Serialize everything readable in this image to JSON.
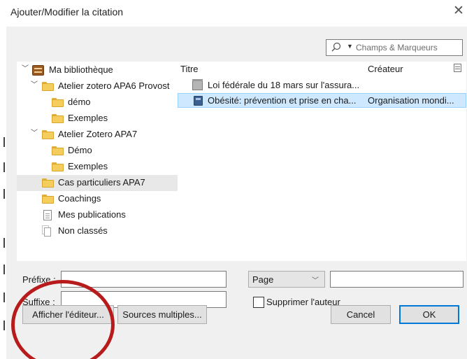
{
  "window": {
    "title": "Ajouter/Modifier la citation",
    "close_glyph": "✕"
  },
  "search": {
    "placeholder": "Champs & Marqueurs",
    "icon": "search-icon",
    "dropdown_icon": "caret-down-icon"
  },
  "tree": [
    {
      "label": "Ma bibliothèque",
      "icon": "library-icon",
      "expanded": true,
      "level": 0
    },
    {
      "label": "Atelier zotero APA6 Provost",
      "icon": "folder-icon",
      "expanded": true,
      "level": 1
    },
    {
      "label": "démo",
      "icon": "folder-icon",
      "level": 2
    },
    {
      "label": "Exemples",
      "icon": "folder-icon",
      "level": 2
    },
    {
      "label": "Atelier Zotero APA7",
      "icon": "folder-icon",
      "expanded": true,
      "level": 1
    },
    {
      "label": "Démo",
      "icon": "folder-icon",
      "level": 2
    },
    {
      "label": "Exemples",
      "icon": "folder-icon",
      "level": 2
    },
    {
      "label": "Cas particuliers APA7",
      "icon": "folder-icon",
      "level": 1,
      "selected": true
    },
    {
      "label": "Coachings",
      "icon": "folder-icon",
      "level": 1
    },
    {
      "label": "Mes publications",
      "icon": "document-icon",
      "level": 1
    },
    {
      "label": "Non classés",
      "icon": "unfiled-icon",
      "level": 1
    }
  ],
  "items": {
    "columns": {
      "title": "Titre",
      "creator": "Créateur"
    },
    "rows": [
      {
        "title": "Loi fédérale du 18 mars sur l'assura...",
        "creator": "",
        "icon": "statute-icon",
        "selected": false
      },
      {
        "title": "Obésité: prévention et prise en cha...",
        "creator": "Organisation mondi...",
        "icon": "book-icon",
        "selected": true
      }
    ]
  },
  "form": {
    "prefix_label": "Préfixe :",
    "prefix_value": "",
    "suffix_label": "Suffixe :",
    "suffix_value": "",
    "locator_selected": "Page",
    "locator_value": "",
    "suppress_author_label": "Supprimer l'auteur",
    "suppress_author_checked": false
  },
  "buttons": {
    "show_editor": "Afficher l'éditeur...",
    "multiple_sources": "Sources multiples...",
    "cancel": "Cancel",
    "ok": "OK"
  },
  "colors": {
    "selection_blue": "#cde8ff",
    "annotation_red": "#b71b1b",
    "focus_blue": "#0078d7"
  }
}
